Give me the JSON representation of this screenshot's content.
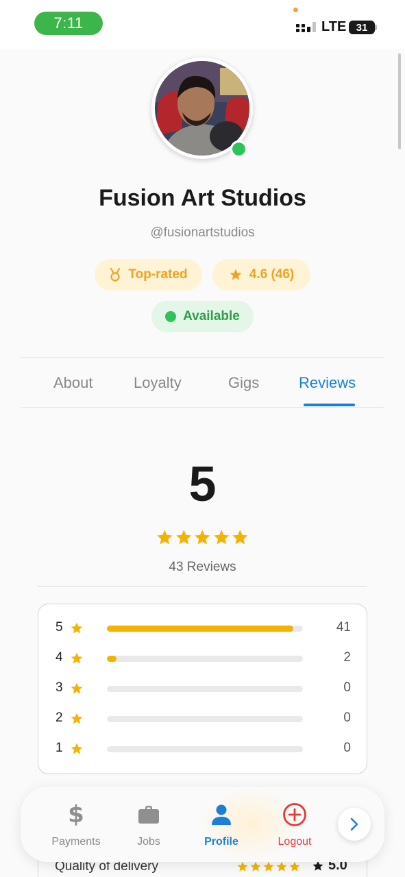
{
  "status_bar": {
    "time": "7:11",
    "network": "LTE",
    "battery": "31"
  },
  "profile": {
    "name": "Fusion Art Studios",
    "handle": "@fusionartstudios",
    "badges": {
      "top_rated": "Top-rated",
      "rating": "4.6 (46)",
      "availability": "Available"
    }
  },
  "tabs": [
    {
      "label": "About"
    },
    {
      "label": "Loyalty"
    },
    {
      "label": "Gigs"
    },
    {
      "label": "Reviews",
      "active": true
    }
  ],
  "reviews": {
    "average": "5",
    "stars_shown": 5,
    "count_label": "43 Reviews",
    "breakdown": [
      {
        "stars": "5",
        "count": "41",
        "fraction": 0.95
      },
      {
        "stars": "4",
        "count": "2",
        "fraction": 0.05
      },
      {
        "stars": "3",
        "count": "0",
        "fraction": 0
      },
      {
        "stars": "2",
        "count": "0",
        "fraction": 0
      },
      {
        "stars": "1",
        "count": "0",
        "fraction": 0
      }
    ],
    "quality": {
      "label": "Quality of delivery",
      "score": "5.0"
    }
  },
  "bottom_nav": {
    "items": [
      {
        "label": "Payments",
        "icon": "dollar-icon"
      },
      {
        "label": "Jobs",
        "icon": "briefcase-icon"
      },
      {
        "label": "Profile",
        "icon": "person-icon",
        "active": true
      },
      {
        "label": "Logout",
        "icon": "logout-icon"
      }
    ],
    "next_icon": "chevron-right-icon"
  },
  "colors": {
    "accent": "#1b7fd9",
    "star": "#f5b301",
    "online": "#2cc45a",
    "logout": "#e53935"
  }
}
